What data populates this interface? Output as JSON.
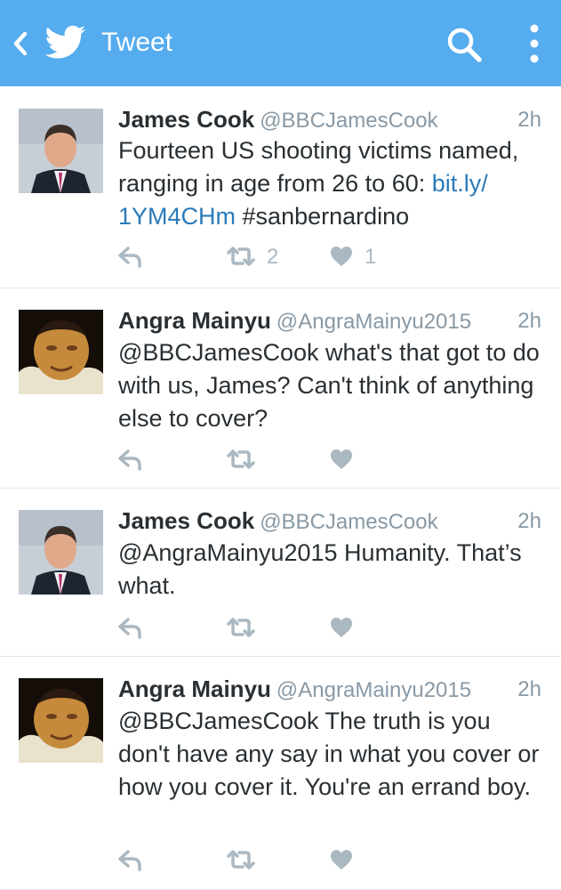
{
  "header": {
    "title": "Tweet",
    "color": "#55acee",
    "icons": [
      "back-chevron-icon",
      "twitter-bird-icon",
      "search-icon",
      "more-vertical-icon"
    ]
  },
  "tweets": [
    {
      "name": "James Cook",
      "handle": "@BBCJamesCook",
      "time": "2h",
      "text_before": "Fourteen US shooting victims named, ranging in age from 26 to 60: ",
      "link": "bit.ly/ 1YM4CHm",
      "text_after": " #sanbernardino",
      "retweets": "2",
      "likes": "1"
    },
    {
      "name": "Angra Mainyu",
      "handle": "@AngraMainyu2015",
      "time": "2h",
      "text": "@BBCJamesCook what's that got to do with us, James? Can't think of anything else to cover?"
    },
    {
      "name": "James Cook",
      "handle": "@BBCJamesCook",
      "time": "2h",
      "text": "@AngraMainyu2015 Humanity. That’s what."
    },
    {
      "name": "Angra Mainyu",
      "handle": "@AngraMainyu2015",
      "time": "2h",
      "text": "@BBCJamesCook The truth is you don't have any say in what you cover or how you cover it. You're an errand boy."
    }
  ]
}
